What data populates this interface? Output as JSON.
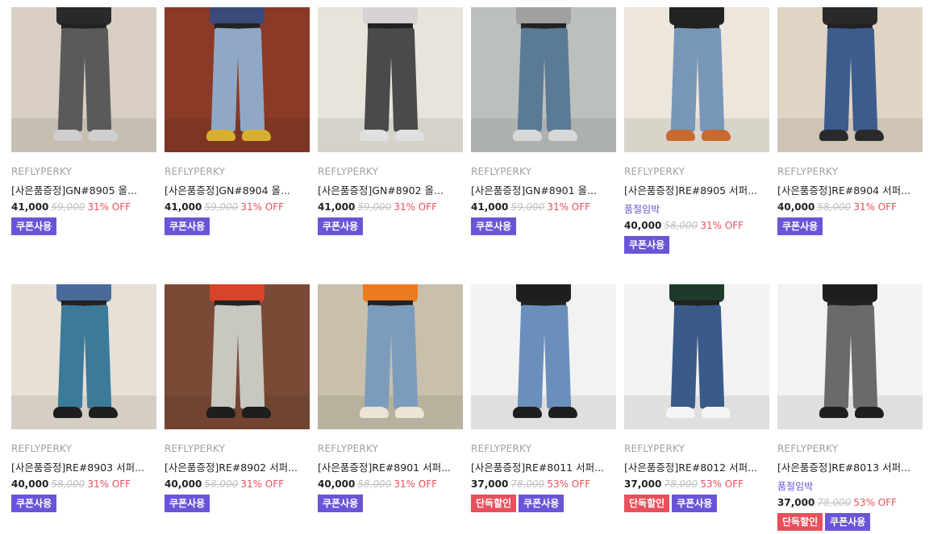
{
  "products": [
    {
      "brand": "REFLYPERKY",
      "title": "[사은품증정]GN#8905 올...",
      "soldout": "",
      "price": "41,000",
      "orig": "59,000",
      "off": "31% OFF",
      "badges": [
        "쿠폰사용"
      ],
      "colors": {
        "bg": "#d8cfc2",
        "torso": "#2a2a2a",
        "leg": "#5a5a5a",
        "shoe": "#cfcfcf"
      }
    },
    {
      "brand": "REFLYPERKY",
      "title": "[사은품증정]GN#8904 올...",
      "soldout": "",
      "price": "41,000",
      "orig": "59,000",
      "off": "31% OFF",
      "badges": [
        "쿠폰사용"
      ],
      "colors": {
        "bg": "#8a3a26",
        "torso": "#3a4a7a",
        "leg": "#8fa8c6",
        "shoe": "#d8b030"
      }
    },
    {
      "brand": "REFLYPERKY",
      "title": "[사은품증정]GN#8902 올...",
      "soldout": "",
      "price": "41,000",
      "orig": "59,000",
      "off": "31% OFF",
      "badges": [
        "쿠폰사용"
      ],
      "colors": {
        "bg": "#e8e4dc",
        "torso": "#d8d2d6",
        "leg": "#4a4a4a",
        "shoe": "#e0e0e0"
      }
    },
    {
      "brand": "REFLYPERKY",
      "title": "[사은품증정]GN#8901 올...",
      "soldout": "",
      "price": "41,000",
      "orig": "59,000",
      "off": "31% OFF",
      "badges": [
        "쿠폰사용"
      ],
      "colors": {
        "bg": "#bcc0bc",
        "torso": "#a0a0a0",
        "leg": "#5a7a96",
        "shoe": "#d8d8d8"
      }
    },
    {
      "brand": "REFLYPERKY",
      "title": "[사은품증정]RE#8905 서퍼...",
      "soldout": "품절임박",
      "price": "40,000",
      "orig": "58,000",
      "off": "31% OFF",
      "badges": [
        "쿠폰사용"
      ],
      "colors": {
        "bg": "#ece6dc",
        "torso": "#222222",
        "leg": "#7896b8",
        "shoe": "#c86a30"
      }
    },
    {
      "brand": "REFLYPERKY",
      "title": "[사은품증정]RE#8904 서퍼...",
      "soldout": "",
      "price": "40,000",
      "orig": "58,000",
      "off": "31% OFF",
      "badges": [
        "쿠폰사용"
      ],
      "colors": {
        "bg": "#e0d4c4",
        "torso": "#2a2a2a",
        "leg": "#3c5c8c",
        "shoe": "#2a2a2a"
      }
    },
    {
      "brand": "REFLYPERKY",
      "title": "[사은품증정]RE#8903 서퍼...",
      "soldout": "",
      "price": "40,000",
      "orig": "58,000",
      "off": "31% OFF",
      "badges": [
        "쿠폰사용"
      ],
      "colors": {
        "bg": "#e6e0d6",
        "torso": "#4a6a9a",
        "leg": "#3c7a9a",
        "shoe": "#1e1e1e"
      }
    },
    {
      "brand": "REFLYPERKY",
      "title": "[사은품증정]RE#8902 서퍼...",
      "soldout": "",
      "price": "40,000",
      "orig": "58,000",
      "off": "31% OFF",
      "badges": [
        "쿠폰사용"
      ],
      "colors": {
        "bg": "#7a4a36",
        "torso": "#d8442a",
        "leg": "#c8c8c0",
        "shoe": "#1e1e1e"
      }
    },
    {
      "brand": "REFLYPERKY",
      "title": "[사은품증정]RE#8901 서퍼...",
      "soldout": "",
      "price": "40,000",
      "orig": "58,000",
      "off": "31% OFF",
      "badges": [
        "쿠폰사용"
      ],
      "colors": {
        "bg": "#c8c0ac",
        "torso": "#ee7a20",
        "leg": "#7c9cbc",
        "shoe": "#ece4d4"
      }
    },
    {
      "brand": "REFLYPERKY",
      "title": "[사은품증정]RE#8011 서퍼...",
      "soldout": "",
      "price": "37,000",
      "orig": "78,000",
      "off": "53% OFF",
      "badges": [
        "단독할인",
        "쿠폰사용"
      ],
      "colors": {
        "bg": "#f2f2f2",
        "torso": "#1e1e1e",
        "leg": "#6a8fbc",
        "shoe": "#1e1e1e"
      }
    },
    {
      "brand": "REFLYPERKY",
      "title": "[사은품증정]RE#8012 서퍼...",
      "soldout": "",
      "price": "37,000",
      "orig": "78,000",
      "off": "53% OFF",
      "badges": [
        "단독할인",
        "쿠폰사용"
      ],
      "colors": {
        "bg": "#f2f2f2",
        "torso": "#1e3a2a",
        "leg": "#3a5a8a",
        "shoe": "#f4f4f4"
      }
    },
    {
      "brand": "REFLYPERKY",
      "title": "[사은품증정]RE#8013 서퍼...",
      "soldout": "품절임박",
      "price": "37,000",
      "orig": "78,000",
      "off": "53% OFF",
      "badges": [
        "단독할인",
        "쿠폰사용"
      ],
      "colors": {
        "bg": "#f2f2f2",
        "torso": "#1e1e1e",
        "leg": "#6a6a6a",
        "shoe": "#1e1e1e"
      }
    }
  ],
  "badge_colors": {
    "쿠폰사용": "#6a55d8",
    "단독할인": "#e8505b"
  }
}
